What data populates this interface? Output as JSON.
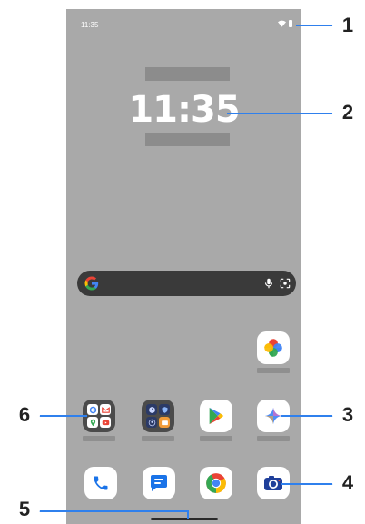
{
  "status_bar": {
    "time": "11:35",
    "wifi_icon": "wifi-icon",
    "battery_icon": "battery-icon"
  },
  "clock": {
    "time": "11:35"
  },
  "search_bar": {
    "logo": "google-g-icon",
    "mic": "mic-icon",
    "lens": "lens-icon"
  },
  "apps": {
    "photos": "photos-icon",
    "google_folder": "google-folder",
    "tools_folder": "tools-folder",
    "play_store": "play-store-icon",
    "gemini": "gemini-icon"
  },
  "dock": [
    "phone-icon",
    "messages-icon",
    "chrome-icon",
    "camera-icon"
  ],
  "callouts": [
    "1",
    "2",
    "3",
    "4",
    "5",
    "6"
  ],
  "colors": {
    "screen_bg": "#a9a9a9",
    "callout_line": "#2f80ed"
  }
}
